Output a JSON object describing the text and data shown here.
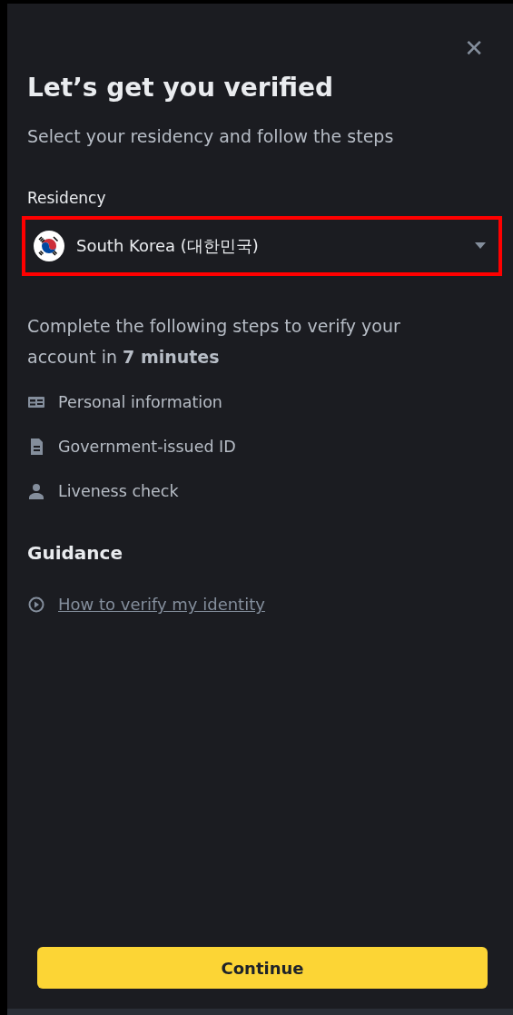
{
  "close_button": {
    "label": "✕"
  },
  "title": "Let’s get you verified",
  "subtitle": "Select your residency and follow the steps",
  "residency": {
    "label": "Residency",
    "value": "South Korea (대한민국)",
    "highlighted": true
  },
  "intro": "Complete the following steps to verify your account in **7 minutes**",
  "steps": [
    {
      "kind": "id-card",
      "label": "Personal information"
    },
    {
      "kind": "document",
      "label": "Government-issued ID"
    },
    {
      "kind": "person",
      "label": "Liveness check"
    }
  ],
  "guidance": {
    "heading": "Guidance",
    "link": "How to verify my identity"
  },
  "continue_button": "Continue"
}
